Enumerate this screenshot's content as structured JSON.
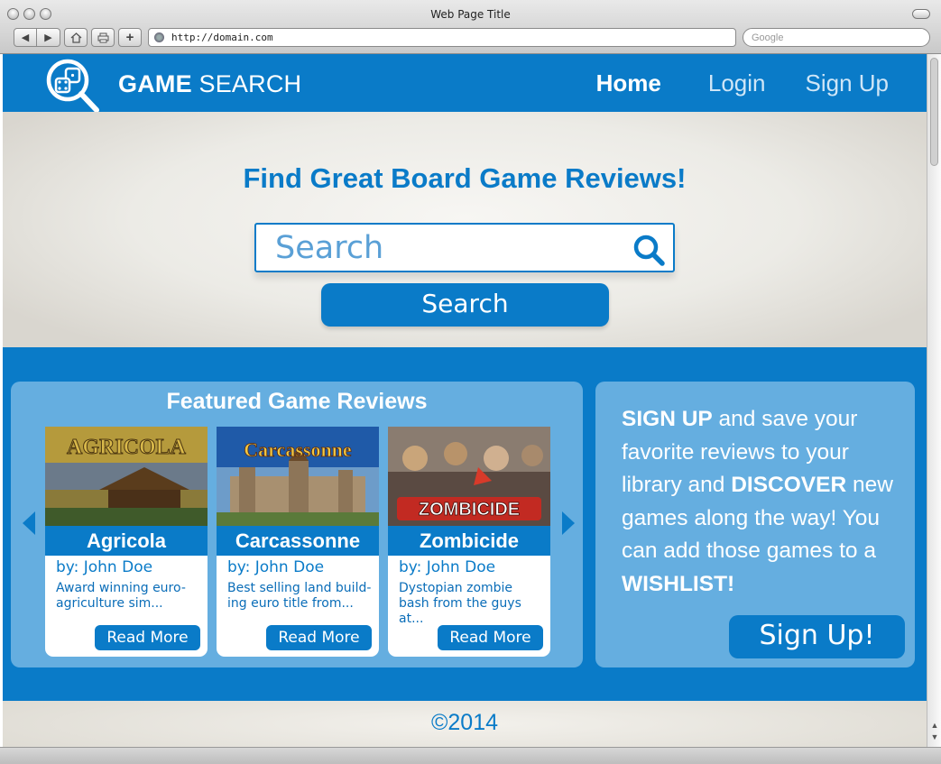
{
  "browser": {
    "window_title": "Web Page Title",
    "url": "http://domain.com",
    "search_placeholder": "Google"
  },
  "header": {
    "brand_bold": "GAME",
    "brand_light": "SEARCH",
    "nav": {
      "home": "Home",
      "login": "Login",
      "signup": "Sign Up"
    }
  },
  "hero": {
    "title": "Find Great Board Game Reviews!",
    "search_placeholder": "Search",
    "search_button": "Search"
  },
  "featured": {
    "title": "Featured Game Reviews",
    "cards": [
      {
        "name": "Agricola",
        "author": "by: John Doe",
        "desc": "Award winning euro-agriculture sim...",
        "button": "Read More",
        "art_text": "AGRICOLA"
      },
      {
        "name": "Carcassonne",
        "author": "by: John Doe",
        "desc": "Best selling land build-ing euro title from...",
        "button": "Read More",
        "art_text": "Carcassonne"
      },
      {
        "name": "Zombicide",
        "author": "by: John Doe",
        "desc": "Dystopian zombie bash from the guys at...",
        "button": "Read More",
        "art_text": "ZOMBICIDE"
      }
    ]
  },
  "signup_panel": {
    "t1": "SIGN UP",
    "t2": " and save your favorite reviews to your library and ",
    "t3": "DISCOVER",
    "t4": " new games along the way! You can add those games to a ",
    "t5": "WISHLIST!",
    "button": "Sign Up!"
  },
  "footer": {
    "copyright": "©2014"
  },
  "colors": {
    "primary": "#0a7bc8",
    "panel": "#65aee0",
    "hero_bg": "#ecebe6"
  }
}
